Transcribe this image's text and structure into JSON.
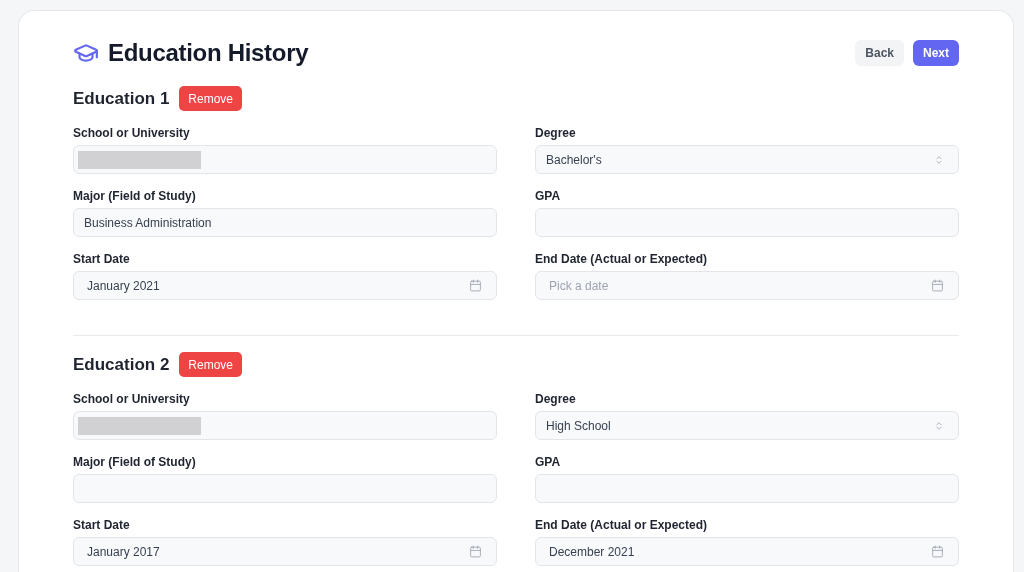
{
  "page": {
    "title": "Education History"
  },
  "actions": [
    {
      "label": "Back",
      "kind": "secondary"
    },
    {
      "label": "Next",
      "kind": "primary"
    }
  ],
  "educations": [
    {
      "heading": "Education 1",
      "remove_label": "Remove",
      "fields": [
        {
          "label": "School or University",
          "kind": "text",
          "redacted": true
        },
        {
          "label": "Degree",
          "kind": "select",
          "value": "Bachelor's"
        },
        {
          "label": "Major (Field of Study)",
          "kind": "text",
          "value": "Business Administration"
        },
        {
          "label": "GPA",
          "kind": "text"
        },
        {
          "label": "Start Date",
          "kind": "date",
          "value": "January 2021"
        },
        {
          "label": "End Date (Actual or Expected)",
          "kind": "date",
          "placeholder": "Pick a date"
        }
      ]
    },
    {
      "heading": "Education 2",
      "remove_label": "Remove",
      "fields": [
        {
          "label": "School or University",
          "kind": "text",
          "redacted": true
        },
        {
          "label": "Degree",
          "kind": "select",
          "value": "High School"
        },
        {
          "label": "Major (Field of Study)",
          "kind": "text"
        },
        {
          "label": "GPA",
          "kind": "text"
        },
        {
          "label": "Start Date",
          "kind": "date",
          "value": "January 2017"
        },
        {
          "label": "End Date (Actual or Expected)",
          "kind": "date",
          "value": "December 2021"
        }
      ]
    }
  ]
}
